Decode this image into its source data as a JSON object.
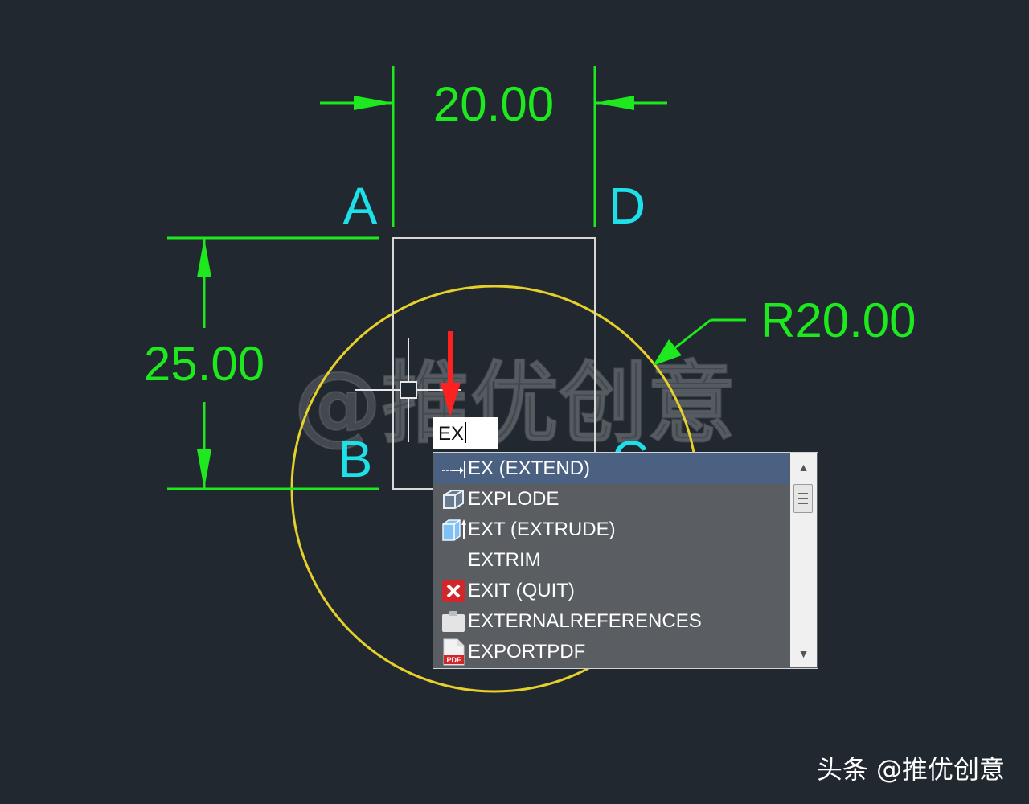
{
  "drawing": {
    "dim_width": "20.00",
    "dim_height": "25.00",
    "dim_radius": "R20.00",
    "points": {
      "a": "A",
      "b": "B",
      "c": "C",
      "d": "D"
    },
    "watermark": "@推优创意",
    "colors": {
      "background": "#212830",
      "dimension": "#1ee81e",
      "point_label": "#1ee0e8",
      "circle": "#e6d02a",
      "rectangle": "#d8d8d8",
      "arrow": "#ff2020"
    }
  },
  "command": {
    "input_value": "EX"
  },
  "autocomplete": {
    "items": [
      {
        "label": "EX (EXTEND)",
        "icon": "extend-icon",
        "selected": true
      },
      {
        "label": "EXPLODE",
        "icon": "explode-icon",
        "selected": false
      },
      {
        "label": "EXT (EXTRUDE)",
        "icon": "extrude-icon",
        "selected": false
      },
      {
        "label": "EXTRIM",
        "icon": "",
        "selected": false
      },
      {
        "label": "EXIT (QUIT)",
        "icon": "close-icon",
        "selected": false
      },
      {
        "label": "EXTERNALREFERENCES",
        "icon": "clipboard-icon",
        "selected": false
      },
      {
        "label": "EXPORTPDF",
        "icon": "pdf-file-icon",
        "selected": false
      }
    ],
    "scroll": {
      "up_icon": "scroll-up-icon",
      "down_icon": "scroll-down-icon"
    }
  },
  "credit": "头条 @推优创意"
}
